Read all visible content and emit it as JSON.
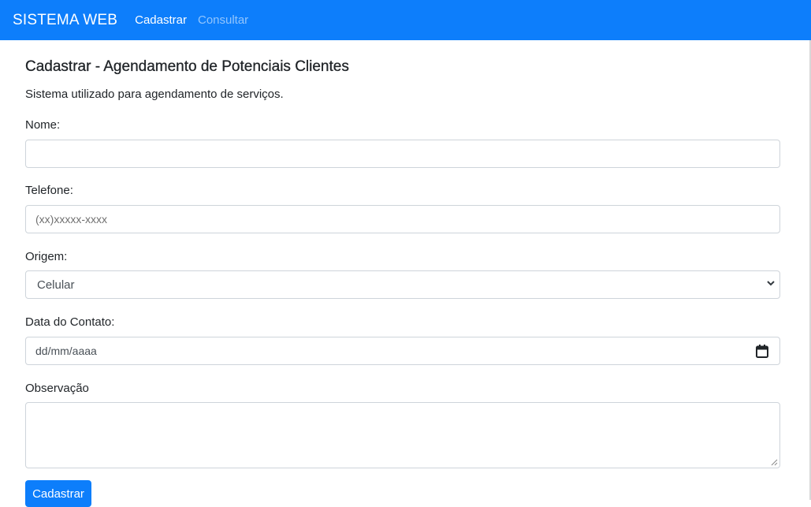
{
  "navbar": {
    "brand": "SISTEMA WEB",
    "links": [
      {
        "label": "Cadastrar",
        "active": true
      },
      {
        "label": "Consultar",
        "active": false
      }
    ],
    "color": "#0d7efb"
  },
  "page": {
    "title": "Cadastrar - Agendamento de Potenciais Clientes",
    "subtitle": "Sistema utilizado para agendamento de serviços."
  },
  "form": {
    "nome": {
      "label": "Nome:",
      "value": ""
    },
    "telefone": {
      "label": "Telefone:",
      "placeholder": "(xx)xxxxx-xxxx"
    },
    "origem": {
      "label": "Origem:",
      "selected": "Celular"
    },
    "data_contato": {
      "label": "Data do Contato:",
      "placeholder": "dd/mm/aaaa"
    },
    "observacao": {
      "label": "Observação",
      "value": ""
    },
    "submit_label": "Cadastrar"
  },
  "icons": {
    "select": "chevron-down-icon",
    "date": "calendar-icon"
  }
}
